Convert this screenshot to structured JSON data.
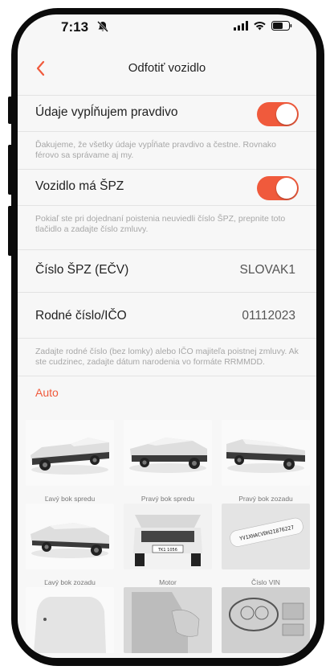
{
  "status": {
    "time": "7:13"
  },
  "nav": {
    "title": "Odfotiť vozidlo"
  },
  "rows": {
    "truthful_label": "Údaje vypĺňujem pravdivo",
    "truthful_hint": "Ďakujeme, že všetky údaje vypĺňate pravdivo a čestne. Rovnako férovo sa správame aj my.",
    "spz_label": "Vozidlo má ŠPZ",
    "spz_hint": "Pokiaľ ste pri dojednaní poistenia neuviedli číslo ŠPZ, prepnite toto tlačidlo a zadajte číslo zmluvy.",
    "plate_label": "Číslo ŠPZ (EČV)",
    "plate_value": "SLOVAK1",
    "id_label": "Rodné číslo/IČO",
    "id_value": "01112023",
    "id_hint": "Zadajte rodné číslo (bez lomky) alebo IČO majiteľa poistnej zmluvy. Ak ste cudzinec, zadajte dátum narodenia vo formáte RRMMDD."
  },
  "section_title": "Auto",
  "tiles": [
    {
      "caption": "Ľavý bok spredu"
    },
    {
      "caption": "Pravý bok spredu"
    },
    {
      "caption": "Pravý bok zozadu"
    },
    {
      "caption": "Ľavý bok zozadu"
    },
    {
      "caption": "Motor"
    },
    {
      "caption": "Číslo VIN"
    }
  ],
  "vin_text": "YV1XHACVDH21876227",
  "motor_plate_text": "TK1 1056",
  "accent_color": "#f05a3c"
}
